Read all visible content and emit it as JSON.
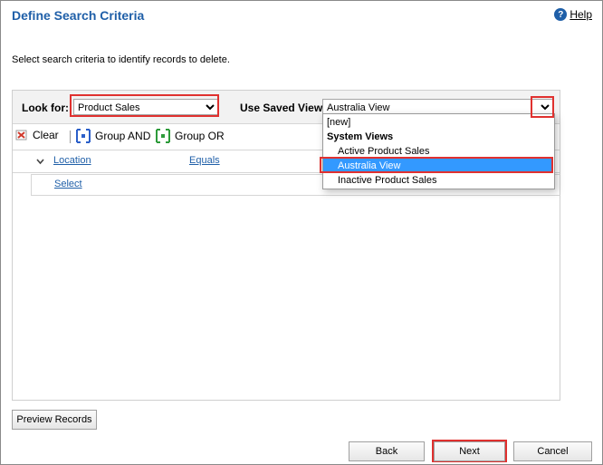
{
  "dialog": {
    "title": "Define Search Criteria",
    "help_label": "Help",
    "instructions": "Select search criteria to identify records to delete."
  },
  "criteria": {
    "look_for_label": "Look for:",
    "look_for_value": "Product Sales",
    "saved_view_label": "Use Saved View:",
    "saved_view_value": "Australia View"
  },
  "toolbar": {
    "clear_label": "Clear",
    "group_and_label": "Group AND",
    "group_or_label": "Group OR"
  },
  "filter": {
    "field_label": "Location",
    "operator_label": "Equals",
    "select_label": "Select"
  },
  "view_dropdown": {
    "items": [
      {
        "label": "[new]"
      },
      {
        "label": "System Views"
      },
      {
        "label": "Active Product Sales"
      },
      {
        "label": "Australia View"
      },
      {
        "label": "Inactive Product Sales"
      }
    ],
    "selected_index": 3
  },
  "buttons": {
    "preview_label": "Preview Records",
    "back_label": "Back",
    "next_label": "Next",
    "cancel_label": "Cancel"
  },
  "colors": {
    "title": "#1f5fa8",
    "highlight": "#3399ff",
    "callout": "#e0312f"
  }
}
